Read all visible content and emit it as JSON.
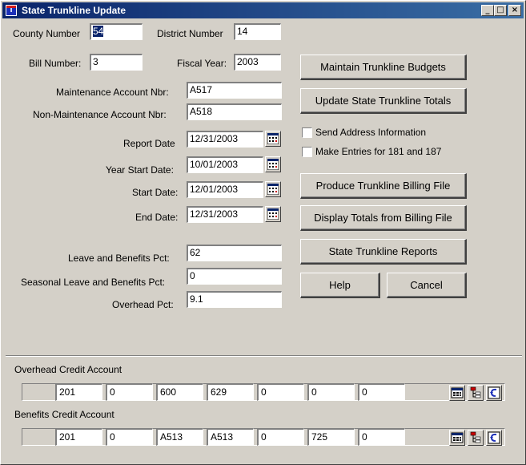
{
  "window": {
    "title": "State Trunkline Update",
    "icon_text": "T",
    "controls": {
      "minimize": "_",
      "maximize": "□",
      "close": "×"
    }
  },
  "form": {
    "county_number": {
      "label": "County Number",
      "value": "54"
    },
    "district_number": {
      "label": "District Number",
      "value": "14"
    },
    "bill_number": {
      "label": "Bill Number:",
      "value": "3"
    },
    "fiscal_year": {
      "label": "Fiscal Year:",
      "value": "2003"
    },
    "maintenance_account": {
      "label": "Maintenance Account Nbr:",
      "value": "A517"
    },
    "non_maintenance_account": {
      "label": "Non-Maintenance Account Nbr:",
      "value": "A518"
    },
    "report_date": {
      "label": "Report Date",
      "value": "12/31/2003"
    },
    "year_start_date": {
      "label": "Year Start Date:",
      "value": "10/01/2003"
    },
    "start_date": {
      "label": "Start Date:",
      "value": "12/01/2003"
    },
    "end_date": {
      "label": "End Date:",
      "value": "12/31/2003"
    },
    "leave_benefits_pct": {
      "label": "Leave and Benefits Pct:",
      "value": "62"
    },
    "seasonal_leave_benefits_pct": {
      "label": "Seasonal Leave and Benefits Pct:",
      "value": "0"
    },
    "overhead_pct": {
      "label": "Overhead Pct:",
      "value": "9.1"
    }
  },
  "buttons": {
    "maintain_budgets": "Maintain Trunkline Budgets",
    "update_totals": "Update State Trunkline Totals",
    "produce_billing_file": "Produce Trunkline Billing File",
    "display_totals": "Display Totals from Billing File",
    "reports": "State Trunkline Reports",
    "help": "Help",
    "cancel": "Cancel"
  },
  "checkboxes": {
    "send_address": {
      "label": "Send Address Information",
      "checked": false
    },
    "make_entries": {
      "label": "Make Entries for 181 and 187",
      "checked": false
    }
  },
  "overhead_credit": {
    "label": "Overhead Credit Account",
    "fields": [
      "201",
      "0",
      "600",
      "629",
      "0",
      "0",
      "0"
    ]
  },
  "benefits_credit": {
    "label": "Benefits Credit Account",
    "fields": [
      "201",
      "0",
      "A513",
      "A513",
      "0",
      "725",
      "0"
    ]
  },
  "icons": {
    "calendar": "calendar-icon",
    "account_lookup": "account-lookup-icon",
    "account_tree": "account-tree-icon",
    "undo": "undo-icon"
  }
}
